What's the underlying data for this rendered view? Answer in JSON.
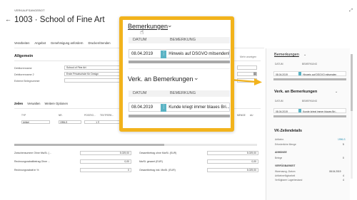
{
  "header": {
    "caption": "VERKAUFSANGEBOT",
    "title": "1003 · School of Fine Art"
  },
  "actions": [
    "Verarbeiten",
    "Angebot",
    "Genehmigung anfordern",
    "Drucken/Senden"
  ],
  "general": {
    "heading": "Allgemein",
    "show_more": "Mehr anzeigen",
    "fields": [
      {
        "label": "Debitorenname",
        "value": "School of Fine Art"
      },
      {
        "label": "Debitorenname 2",
        "value": "Erste Privatschule für Design"
      },
      {
        "label": "Externe Belegnummer",
        "value": ""
      }
    ]
  },
  "lines": {
    "tabs": [
      "Zeilen",
      "Verwalten",
      "Weitere Optionen"
    ],
    "columns": [
      "TYP",
      "NR.",
      "POSITIO...",
      "TEXTFERK...",
      "MENGE",
      "AU"
    ],
    "rows": [
      {
        "type": "Artikel",
        "no": "1996-S",
        "pos": "1",
        "text": ""
      }
    ]
  },
  "totals": {
    "left": [
      {
        "label": "Zwischensumme Ohne MwSt. (...",
        "value": "5.029,00"
      },
      {
        "label": "Rechnungsrabattbetrag Ohne ...",
        "value": "0,00"
      },
      {
        "label": "Rechnungsrabatt in %",
        "value": "0"
      }
    ],
    "right": [
      {
        "label": "Gesamtbetrag ohne MwSt. (EUR)",
        "value": "5.029,00"
      },
      {
        "label": "MwSt. gesamt (EUR)",
        "value": "0,00"
      },
      {
        "label": "Gesamtbetrag inkl. MwSt. (EUR)",
        "value": "5.029,00"
      }
    ]
  },
  "factbox": {
    "remarks_title": "Bemerkungen",
    "remarks_cols": [
      "DATUM",
      "BEMERKUNG"
    ],
    "remarks_row": {
      "date": "08.04.2019",
      "text": "Hinweis auf DSGVO mitsenden"
    },
    "verk_title": "Verk. an Bemerkungen",
    "verk_cols": [
      "DATUM",
      "BEMERKUNG"
    ],
    "verk_row": {
      "date": "08.04.2019",
      "text": "Kunde kriegt immer blaues Bri..."
    },
    "details_title": "VK-Zeilendetails",
    "details": [
      {
        "label": "Artikelnr.",
        "value": "1996-S"
      },
      {
        "label": "Erforderliche Menge",
        "value": "5"
      }
    ],
    "anhaenge_title": "ANHÄNGE",
    "anhaenge": [
      {
        "label": "Belege",
        "value": "0"
      }
    ],
    "verfuegbarkeit_title": "VERFÜGBARKEIT",
    "verfuegbarkeit": [
      {
        "label": "Warenausg.-Datum",
        "value": "08.04.2019"
      },
      {
        "label": "Artikelverfügbarkeit",
        "value": "4"
      },
      {
        "label": "Verfügbarer Lagerbestand",
        "value": "4"
      }
    ]
  },
  "callout": {
    "remarks_title": "Bemerkungen",
    "cols": [
      "DATUM",
      "BEMERKUNG"
    ],
    "remarks_row": {
      "date": "08.04.2019",
      "text": "Hinweis auf DSGVO mitsenden!"
    },
    "verk_title": "Verk. an Bemerkungen",
    "verk_row": {
      "date": "08.04.2019",
      "text": "Kunde kriegt immer blaues Bri..."
    }
  },
  "colors": {
    "accent": "#f2b31c",
    "teal": "#5ab3c4"
  },
  "icons": [
    "back-arrow-icon",
    "expand-icon",
    "calendar-icon",
    "hand-cursor-icon",
    "chevron-down-icon",
    "dots-menu-icon"
  ]
}
